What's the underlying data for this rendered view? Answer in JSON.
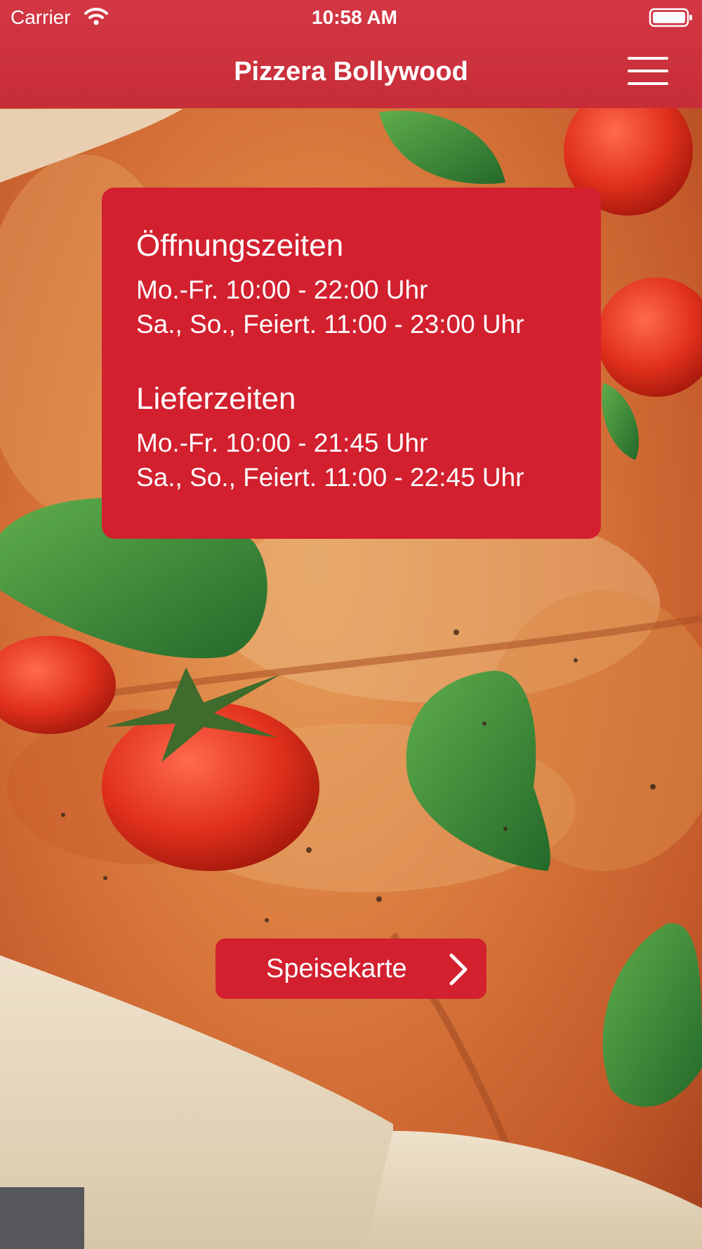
{
  "status_bar": {
    "carrier": "Carrier",
    "time": "10:58 AM"
  },
  "nav": {
    "title": "Pizzera Bollywood",
    "menu_icon": "hamburger-menu-icon"
  },
  "hours_card": {
    "opening": {
      "heading": "Öffnungszeiten",
      "lines": [
        "Mo.-Fr. 10:00 - 22:00 Uhr",
        "Sa., So., Feiert. 11:00 - 23:00 Uhr"
      ]
    },
    "delivery": {
      "heading": "Lieferzeiten",
      "lines": [
        "Mo.-Fr. 10:00 - 21:45 Uhr",
        "Sa., So., Feiert. 11:00 - 22:45 Uhr"
      ]
    }
  },
  "menu_button": {
    "label": "Speisekarte",
    "icon": "chevron-right-icon"
  },
  "colors": {
    "brand_red": "#d2202f",
    "nav_red": "#cc3340"
  }
}
